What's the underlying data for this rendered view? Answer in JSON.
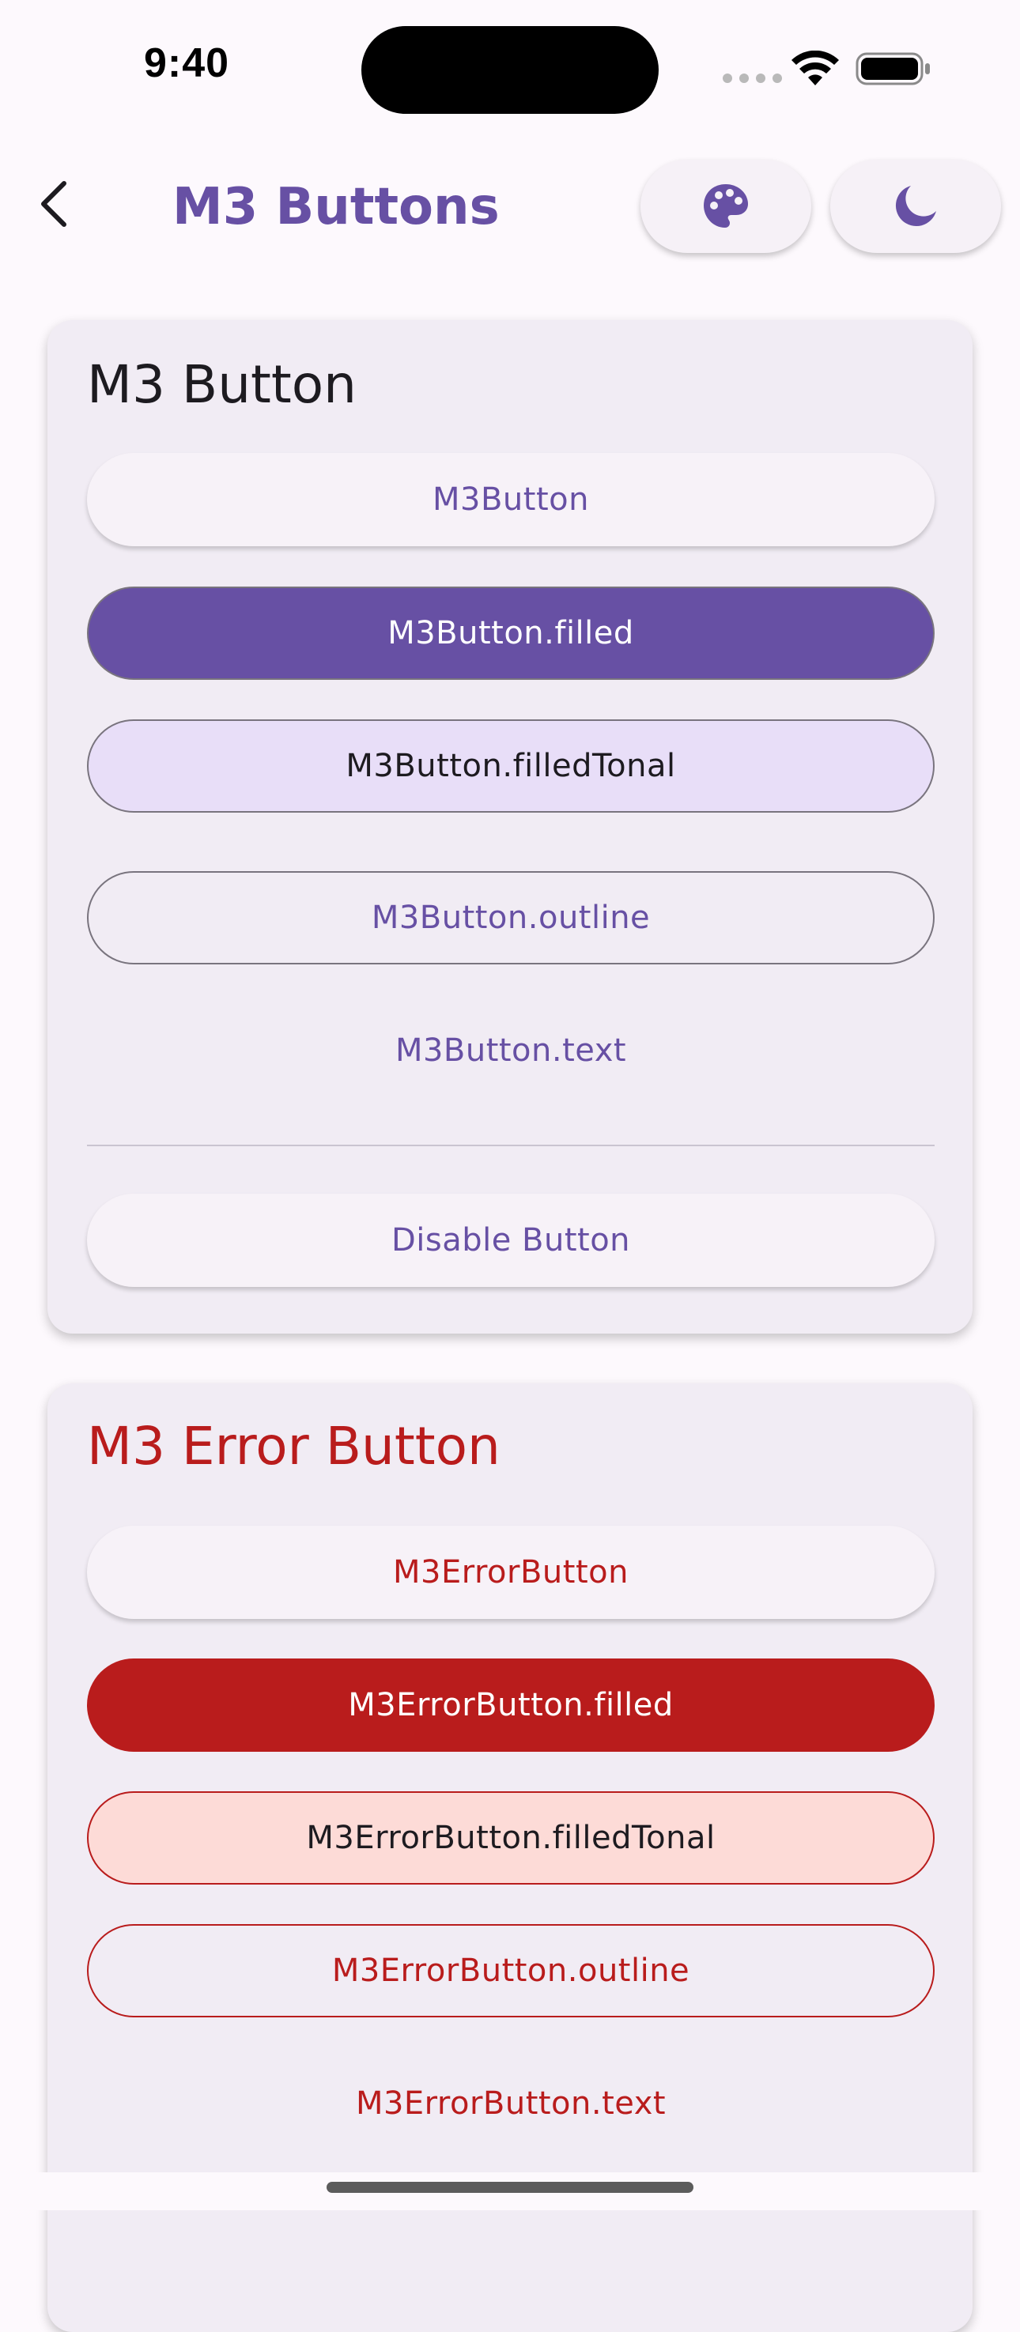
{
  "status_bar": {
    "time": "9:40",
    "icons": [
      "cellular-signal-icon",
      "wifi-icon",
      "battery-icon"
    ]
  },
  "app_bar": {
    "title": "M3 Buttons",
    "back_icon": "chevron-left-icon",
    "actions": [
      {
        "icon": "palette-icon"
      },
      {
        "icon": "moon-icon"
      }
    ]
  },
  "sections": [
    {
      "title": "M3 Button",
      "buttons": [
        {
          "label": "M3Button",
          "variant": "elevated"
        },
        {
          "label": "M3Button.filled",
          "variant": "filled"
        },
        {
          "label": "M3Button.filledTonal",
          "variant": "filledTonal"
        },
        {
          "label": "M3Button.outline",
          "variant": "outline"
        },
        {
          "label": "M3Button.text",
          "variant": "text"
        },
        {
          "label": "Disable Button",
          "variant": "elevated"
        }
      ]
    },
    {
      "title": "M3 Error Button",
      "buttons": [
        {
          "label": "M3ErrorButton",
          "variant": "elevated"
        },
        {
          "label": "M3ErrorButton.filled",
          "variant": "filled"
        },
        {
          "label": "M3ErrorButton.filledTonal",
          "variant": "filledTonal"
        },
        {
          "label": "M3ErrorButton.outline",
          "variant": "outline"
        },
        {
          "label": "M3ErrorButton.text",
          "variant": "text"
        }
      ]
    }
  ],
  "colors": {
    "primary": "#6750a4",
    "primary_container": "#e8def8",
    "error": "#b91c1c",
    "error_container": "#fddbd7",
    "surface": "#fdf9fd",
    "card_surface": "#f1ecf4",
    "outline": "#79747e"
  }
}
